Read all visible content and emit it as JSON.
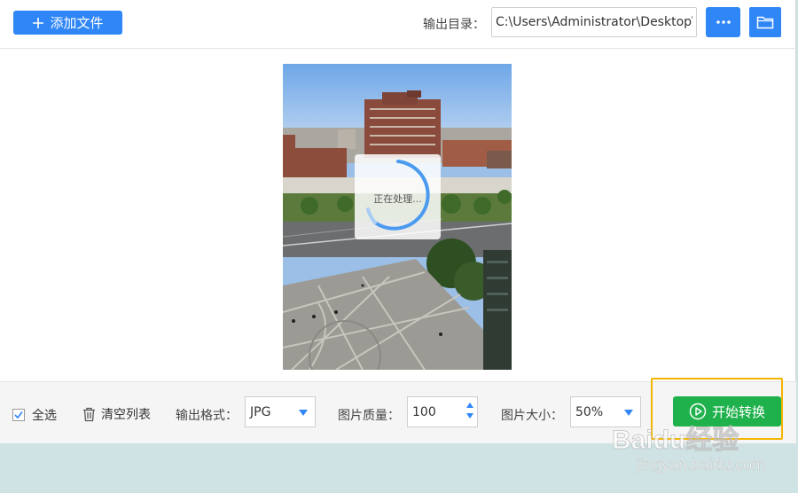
{
  "toolbar": {
    "add_label": "添加文件",
    "output_dir_label": "输出目录：",
    "output_dir_value": "C:\\Users\\Administrator\\Desktop\\",
    "more_label": "•••"
  },
  "preview": {
    "processing_text": "正在处理..."
  },
  "bottom": {
    "select_all_label": "全选",
    "select_all_checked": true,
    "clear_label": "清空列表",
    "format_label": "输出格式：",
    "format_value": "JPG",
    "quality_label": "图片质量：",
    "quality_value": "100",
    "size_label": "图片大小：",
    "size_value": "50%",
    "start_label": "开始转换"
  },
  "watermark": {
    "brand": "Baidu经验",
    "url": "jingyan.baidu.com"
  },
  "colors": {
    "primary": "#2f86f6",
    "start": "#1fb14b",
    "highlight": "#f4b400",
    "background": "#cfe3e4"
  }
}
